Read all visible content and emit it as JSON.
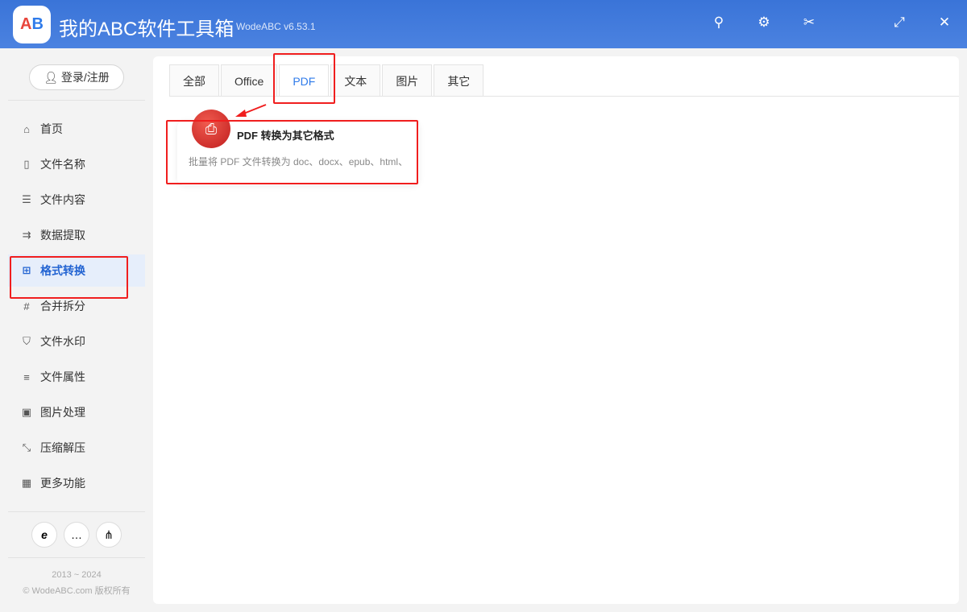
{
  "app": {
    "title": "我的ABC软件工具箱",
    "version": "WodeABC v6.53.1",
    "logo": "AB"
  },
  "window_buttons": [
    "search-icon",
    "gear-icon",
    "scissors-icon",
    "maximize-icon",
    "close-icon"
  ],
  "sidebar": {
    "login": "登录/注册",
    "items": [
      {
        "label": "首页",
        "icon": "⌂"
      },
      {
        "label": "文件名称",
        "icon": "▯"
      },
      {
        "label": "文件内容",
        "icon": "☰"
      },
      {
        "label": "数据提取",
        "icon": "⇉"
      },
      {
        "label": "格式转换",
        "icon": "⊞"
      },
      {
        "label": "合并拆分",
        "icon": "#"
      },
      {
        "label": "文件水印",
        "icon": "⛉"
      },
      {
        "label": "文件属性",
        "icon": "≡"
      },
      {
        "label": "图片处理",
        "icon": "▣"
      },
      {
        "label": "压缩解压",
        "icon": "⤡"
      },
      {
        "label": "更多功能",
        "icon": "▦"
      }
    ],
    "active_index": 4,
    "bottom_icons": [
      "e",
      "…",
      "⋔"
    ],
    "years": "2013 ~ 2024",
    "copyright": "© WodeABC.com 版权所有"
  },
  "tabs": [
    "全部",
    "Office",
    "PDF",
    "文本",
    "图片",
    "其它"
  ],
  "active_tab": 2,
  "card": {
    "title": "PDF 转换为其它格式",
    "desc": "批量将 PDF 文件转换为 doc、docx、epub、html、"
  }
}
